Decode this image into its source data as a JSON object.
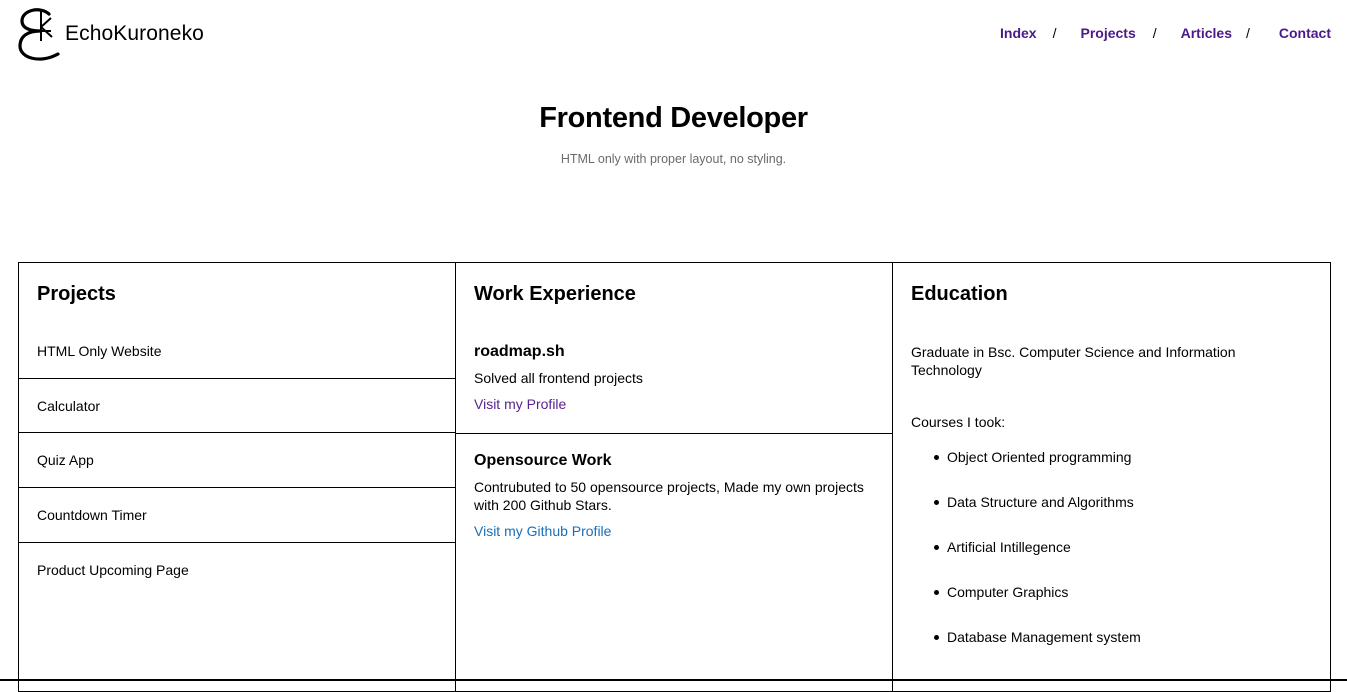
{
  "brand": {
    "name": "EchoKuroneko"
  },
  "nav": {
    "items": [
      "Index",
      "Projects",
      "Articles",
      "Contact"
    ],
    "separator": "/"
  },
  "hero": {
    "title": "Frontend Developer",
    "subtitle": "HTML only with proper layout, no styling."
  },
  "projects": {
    "heading": "Projects",
    "items": [
      "HTML Only Website",
      "Calculator",
      "Quiz App",
      "Countdown Timer",
      "Product Upcoming Page"
    ]
  },
  "work": {
    "heading": "Work Experience",
    "jobs": [
      {
        "title": "roadmap.sh",
        "description": "Solved all frontend projects",
        "link": "Visit my Profile"
      },
      {
        "title": "Opensource Work",
        "description": "Contrubuted to 50 opensource projects, Made my own projects with 200 Github Stars.",
        "link": "Visit my Github Profile"
      }
    ]
  },
  "education": {
    "heading": "Education",
    "degree": "Graduate in Bsc. Computer Science and Information Technology",
    "courses_label": "Courses I took:",
    "courses": [
      "Object Oriented programming",
      "Data Structure and Algorithms",
      "Artificial Intillegence",
      "Computer Graphics",
      "Database Management system"
    ]
  },
  "colors": {
    "nav_link": "#4a1a8a",
    "visited_link": "#5a2390",
    "link": "#1a6fb8",
    "subtitle": "#6b6b6b"
  }
}
